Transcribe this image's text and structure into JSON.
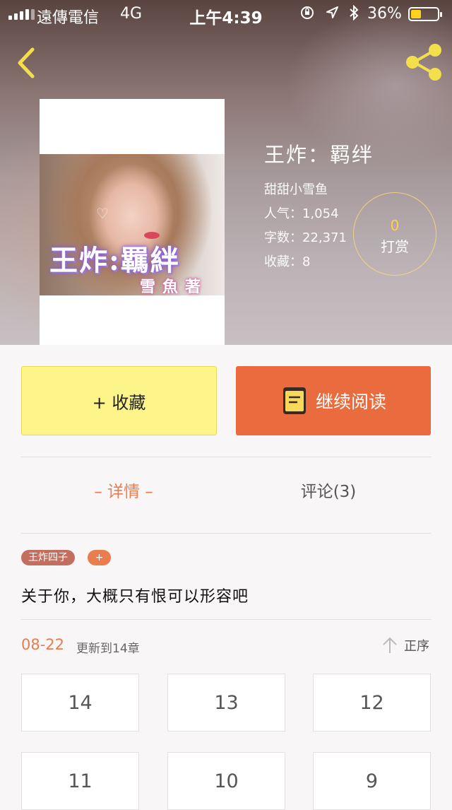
{
  "status_bar": {
    "carrier": "遠傳電信",
    "network": "4G",
    "time": "上午4:39",
    "battery": "36%",
    "battery_level": 0.36,
    "battery_color": "#ffd21f"
  },
  "nav": {
    "back_icon": "chevron-left-icon",
    "share_icon": "share-icon",
    "icon_color": "#f2df4b"
  },
  "cover": {
    "title": "王炸:羈絆",
    "author": "雪魚著"
  },
  "book": {
    "title": "王炸：羁绊",
    "author": "甜甜小雪鱼",
    "popularity": "人气：1,054",
    "word_count": "字数：22,371",
    "favorites": "收藏：8"
  },
  "tip": {
    "count": "0",
    "label": "打赏"
  },
  "actions": {
    "collect_label": "+ 收藏",
    "read_label": "继续阅读",
    "collect_color": "#fdf589",
    "read_color": "#ea6b3d"
  },
  "tabs": {
    "detail": "– 详情 –",
    "comments": "评论(3)",
    "active_color": "#ea7d4e"
  },
  "tags": {
    "items": [
      "王炸四子"
    ],
    "add": "+"
  },
  "description": "关于你，大概只有恨可以形容吧",
  "update": {
    "date": "08-22",
    "text": "更新到14章",
    "sort_label": "正序"
  },
  "chapters": [
    "14",
    "13",
    "12",
    "11",
    "10",
    "9"
  ]
}
